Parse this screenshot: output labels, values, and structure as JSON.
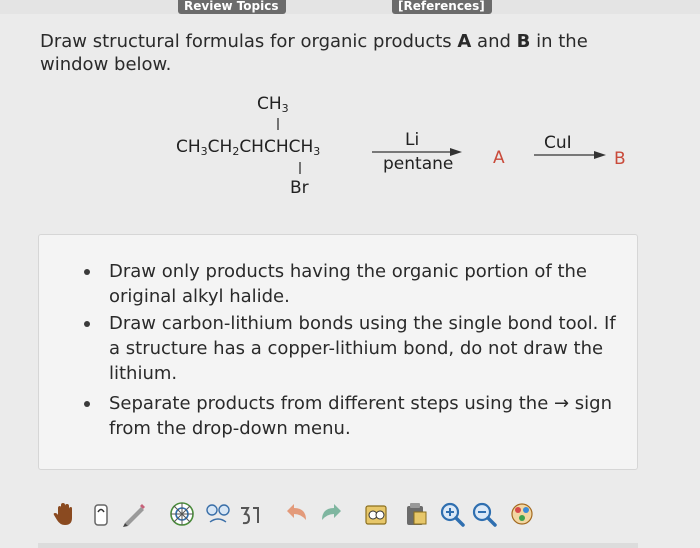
{
  "header": {
    "review_tab": "Review Topics",
    "references_tab": "[References]"
  },
  "question": {
    "prefix": "Draw structural formulas for organic products ",
    "a": "A",
    "and": " and ",
    "b": "B",
    "suffix": " in the window below."
  },
  "reaction": {
    "ch3_top": "CH3",
    "main_chain": "CH3CH2CHCHCH3",
    "substituent": "Br",
    "reagent1_top": "Li",
    "reagent1_bottom": "pentane",
    "product_a": "A",
    "reagent2_top": "CuI",
    "product_b": "B"
  },
  "instructions": [
    "Draw only products having the organic portion of the original alkyl halide.",
    "Draw carbon-lithium bonds using the single bond tool. If a structure has a copper-lithium bond, do not draw the lithium.",
    "Separate products from different steps using the → sign from the drop-down menu."
  ],
  "toolbar": {
    "tools": [
      "hand-icon",
      "eraser-icon",
      "pencil-icon",
      "ring-template-icon",
      "atom-charge-icon",
      "undo-icon",
      "redo-icon",
      "copy-icon",
      "paste-icon",
      "zoom-in-icon",
      "zoom-out-icon",
      "atom-color-icon"
    ]
  },
  "colors": {
    "product_labels": "#c94a3a",
    "panel_background": "#f4f4f4"
  }
}
